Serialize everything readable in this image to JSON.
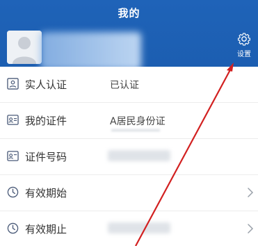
{
  "header": {
    "title": "我的",
    "settings_label": "设置",
    "colors": {
      "header_bg": "#1f63b8",
      "text": "#ffffff"
    }
  },
  "user": {
    "avatar": "default-avatar-icon",
    "name_blurred": true
  },
  "rows": [
    {
      "label": "实人认证",
      "value": "已认证",
      "icon": "id-card-icon",
      "chevron": false
    },
    {
      "label": "我的证件",
      "value": "A居民身份证",
      "icon": "id-card-icon",
      "chevron": false
    },
    {
      "label": "证件号码",
      "value": "",
      "value_blurred": true,
      "icon": "id-card-icon",
      "chevron": false
    },
    {
      "label": "有效期始",
      "value": "",
      "icon": "clock-icon",
      "chevron": true
    },
    {
      "label": "有效期止",
      "value": "",
      "value_blurred": true,
      "icon": "clock-icon",
      "chevron": true
    }
  ],
  "annotation": {
    "arrow_color": "#d22020",
    "points_to": "settings-button"
  }
}
